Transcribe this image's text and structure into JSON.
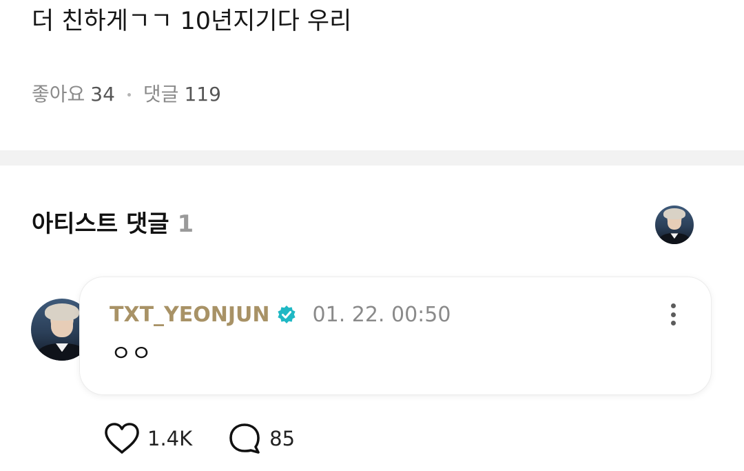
{
  "post": {
    "body": "더 친하게ㄱㄱ 10년지기다 우리",
    "likes_label": "좋아요",
    "likes_count": "34",
    "comments_label": "댓글",
    "comments_count": "119"
  },
  "artist_comments": {
    "title": "아티스트 댓글",
    "count": "1",
    "comment": {
      "author": "TXT_YEONJUN",
      "timestamp": "01. 22. 00:50",
      "text": "ㅇㅇ",
      "like_count": "1.4K",
      "reply_count": "85"
    }
  },
  "icons": {
    "verified": "verified-badge-icon",
    "more": "more-vertical-icon",
    "like": "heart-icon",
    "reply": "speech-bubble-icon"
  },
  "colors": {
    "author": "#a89266",
    "verified": "#1fb8c4",
    "muted": "#8a8a8a",
    "divider": "#f2f2f2"
  }
}
